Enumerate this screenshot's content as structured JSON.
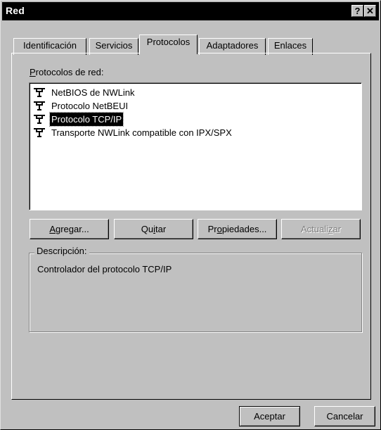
{
  "window": {
    "title": "Red",
    "help_button": "?",
    "close_button": "✕"
  },
  "tabs": [
    {
      "label": "Identificación",
      "active": false
    },
    {
      "label": "Servicios",
      "active": false
    },
    {
      "label": "Protocolos",
      "active": true
    },
    {
      "label": "Adaptadores",
      "active": false
    },
    {
      "label": "Enlaces",
      "active": false
    }
  ],
  "protocols": {
    "label_first": "P",
    "label_rest": "rotocolos de red:",
    "items": [
      {
        "label": "NetBIOS de NWLink",
        "icon": "network-protocol-icon",
        "selected": false
      },
      {
        "label": "Protocolo NetBEUI",
        "icon": "network-protocol-icon",
        "selected": false
      },
      {
        "label": "Protocolo TCP/IP",
        "icon": "network-protocol-icon",
        "selected": true
      },
      {
        "label": "Transporte NWLink compatible con IPX/SPX",
        "icon": "network-protocol-icon",
        "selected": false
      }
    ]
  },
  "actions": {
    "add": {
      "pre": "",
      "key": "A",
      "post": "gregar..."
    },
    "remove": {
      "pre": "Qu",
      "key": "i",
      "post": "tar"
    },
    "properties": {
      "pre": "Pr",
      "key": "o",
      "post": "piedades..."
    },
    "update": {
      "pre": "Actuali",
      "key": "z",
      "post": "ar",
      "enabled": false
    }
  },
  "description": {
    "title": "Descripción:",
    "text": "Controlador del protocolo TCP/IP"
  },
  "footer": {
    "ok": "Aceptar",
    "cancel": "Cancelar"
  }
}
